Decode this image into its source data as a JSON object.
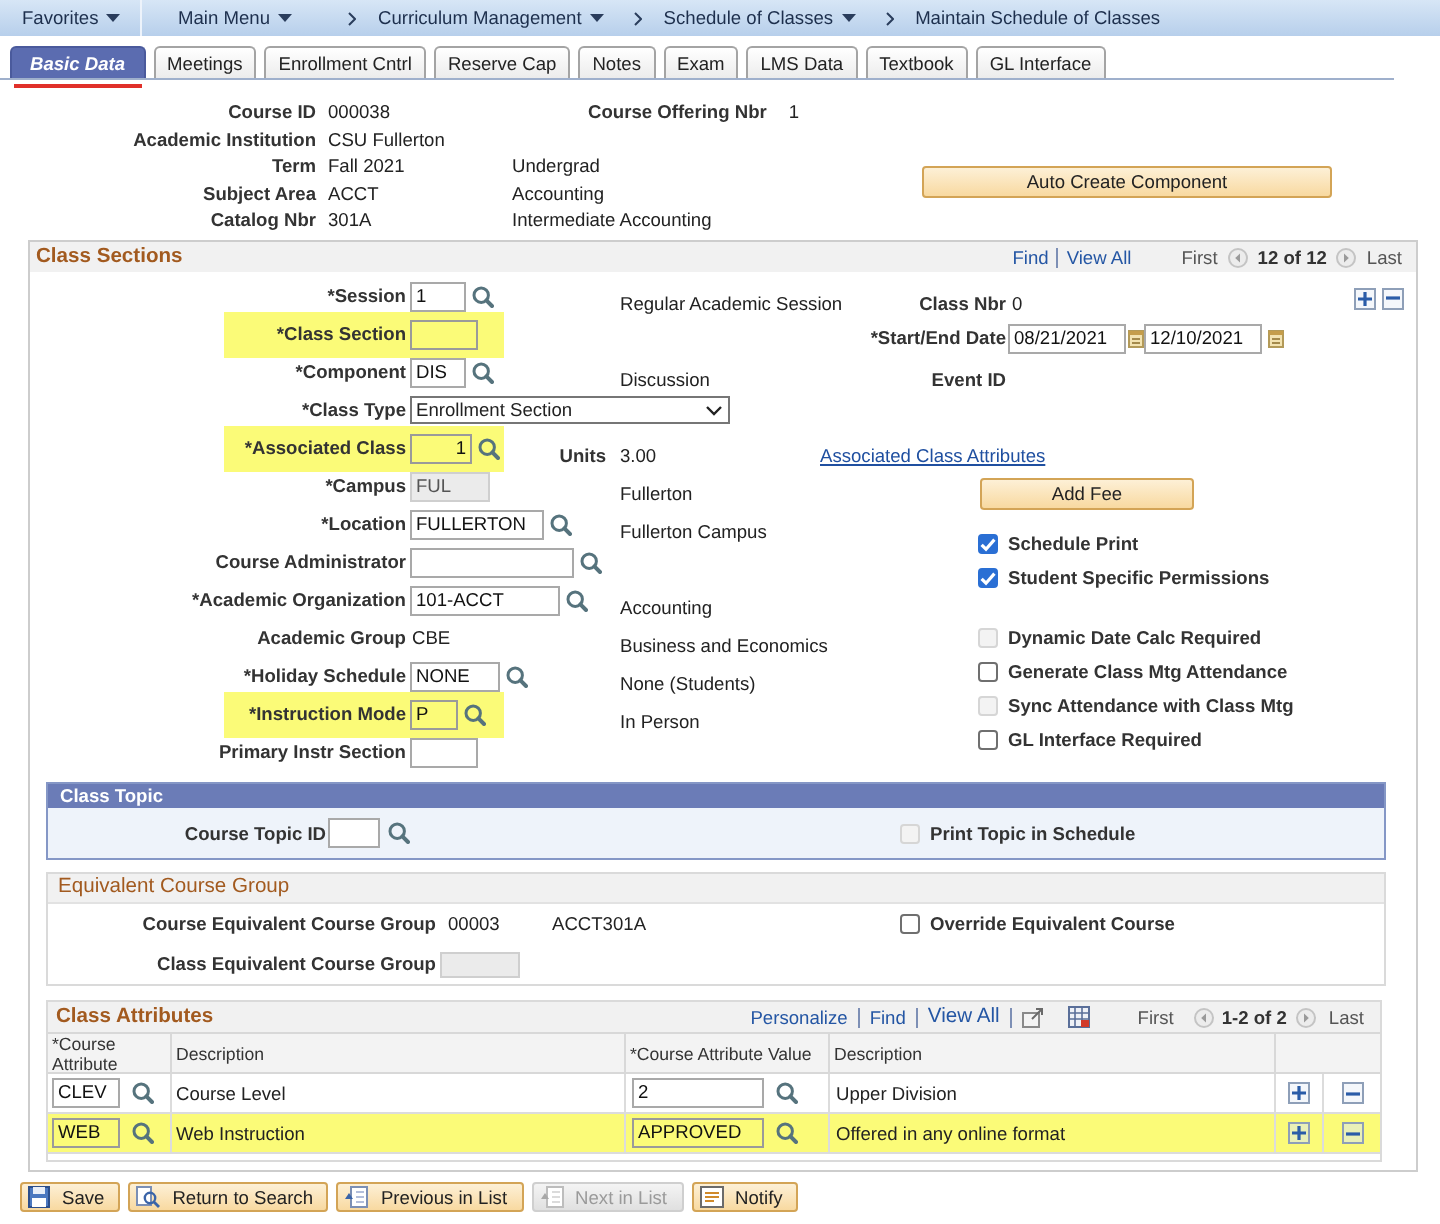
{
  "breadcrumbs": [
    {
      "label": "Favorites",
      "dropdown": true
    },
    {
      "label": "Main Menu",
      "dropdown": true
    },
    {
      "label": "Curriculum Management",
      "dropdown": true
    },
    {
      "label": "Schedule of Classes",
      "dropdown": true
    },
    {
      "label": "Maintain Schedule of Classes",
      "dropdown": false
    }
  ],
  "tabs": [
    {
      "label": "Basic Data",
      "selected": true
    },
    {
      "label": "Meetings",
      "selected": false
    },
    {
      "label": "Enrollment Cntrl",
      "selected": false
    },
    {
      "label": "Reserve Cap",
      "selected": false
    },
    {
      "label": "Notes",
      "selected": false
    },
    {
      "label": "Exam",
      "selected": false
    },
    {
      "label": "LMS Data",
      "selected": false
    },
    {
      "label": "Textbook",
      "selected": false
    },
    {
      "label": "GL Interface",
      "selected": false
    }
  ],
  "course": {
    "fields": [
      {
        "label": "Course ID",
        "value": "000038"
      },
      {
        "label": "Academic Institution",
        "value": "CSU Fullerton"
      },
      {
        "label": "Term",
        "value": "Fall 2021",
        "description": "Undergrad"
      },
      {
        "label": "Subject Area",
        "value": "ACCT",
        "description": "Accounting"
      },
      {
        "label": "Catalog Nbr",
        "value": "301A",
        "description": "Intermediate Accounting"
      }
    ],
    "offering": {
      "label": "Course Offering Nbr",
      "value": "1"
    },
    "action_button": "Auto Create Component"
  },
  "class_sections": {
    "title": "Class Sections",
    "pager": {
      "find": "Find",
      "view_all": "View All",
      "first": "First",
      "position": "12 of 12",
      "last": "Last"
    },
    "fields": [
      {
        "label": "*Session",
        "kind": "lookup",
        "value": "1",
        "description": "Regular Academic Session",
        "highlighted": false
      },
      {
        "label": "*Class Section",
        "kind": "input",
        "highlighted": true
      },
      {
        "label": "*Component",
        "kind": "lookup",
        "value": "DIS",
        "description": "Discussion",
        "highlighted": false
      },
      {
        "label": "*Class Type",
        "kind": "select",
        "value": "Enrollment Section",
        "highlighted": false
      },
      {
        "label": "*Associated Class",
        "kind": "numeric",
        "value": "1",
        "units": {
          "label": "Units",
          "value": "3.00"
        },
        "highlighted": true
      },
      {
        "label": "*Campus",
        "kind": "readonly",
        "value": "FUL",
        "description": "Fullerton",
        "highlighted": false
      },
      {
        "label": "*Location",
        "kind": "lookup",
        "value": "FULLERTON",
        "description": "Fullerton Campus",
        "highlighted": false
      },
      {
        "label": "Course Administrator",
        "kind": "lookup",
        "highlighted": false
      },
      {
        "label": "*Academic Organization",
        "kind": "lookup",
        "value": "101-ACCT",
        "description": "Accounting",
        "highlighted": false
      },
      {
        "label": "Academic Group",
        "kind": "text",
        "value": "CBE",
        "description": "Business and Economics",
        "highlighted": false
      },
      {
        "label": "*Holiday Schedule",
        "kind": "lookup",
        "value": "NONE",
        "description": "None (Students)",
        "highlighted": false
      },
      {
        "label": "*Instruction Mode",
        "kind": "lookup",
        "value": "P",
        "description": "In Person",
        "highlighted": true
      },
      {
        "label": "Primary Instr Section",
        "kind": "input",
        "highlighted": false
      }
    ],
    "side": [
      {
        "kind": "display",
        "label": "Class Nbr",
        "value": "0"
      },
      {
        "kind": "daterange",
        "label": "*Start/End Date",
        "start": "08/21/2021",
        "end": "12/10/2021"
      },
      {
        "kind": "display",
        "label": "Event ID"
      },
      {
        "kind": "link",
        "label": "Associated Class Attributes"
      },
      {
        "kind": "button",
        "label": "Add Fee"
      }
    ],
    "option_groups": [
      {
        "items": [
          {
            "label": "Schedule Print",
            "checked": true,
            "disabled": false
          },
          {
            "label": "Student Specific Permissions",
            "checked": true,
            "disabled": false
          }
        ]
      },
      {
        "items": [
          {
            "label": "Dynamic Date Calc Required",
            "checked": false,
            "disabled": true
          },
          {
            "label": "Generate Class Mtg Attendance",
            "checked": false,
            "disabled": false
          },
          {
            "label": "Sync Attendance with Class Mtg",
            "checked": false,
            "disabled": true
          },
          {
            "label": "GL Interface Required",
            "checked": false,
            "disabled": false
          }
        ]
      }
    ]
  },
  "class_topic": {
    "title": "Class Topic",
    "field": {
      "label": "Course Topic ID"
    },
    "option": {
      "label": "Print Topic in Schedule",
      "checked": false,
      "disabled": true
    }
  },
  "equivalent_course_group": {
    "title": "Equivalent Course Group",
    "course_group": {
      "label": "Course Equivalent Course Group",
      "value": "00003",
      "description": "ACCT301A"
    },
    "class_group": {
      "label": "Class Equivalent Course Group"
    },
    "option": {
      "label": "Override Equivalent Course",
      "checked": false,
      "disabled": false
    }
  },
  "class_attributes": {
    "title": "Class Attributes",
    "toolbar": {
      "personalize": "Personalize",
      "find": "Find",
      "view_all": "View All",
      "first": "First",
      "position": "1-2 of 2",
      "last": "Last"
    },
    "columns": [
      "*Course Attribute",
      "Description",
      "*Course Attribute Value",
      "Description"
    ],
    "rows": [
      {
        "attribute": "CLEV",
        "description": "Course Level",
        "value": "2",
        "value_description": "Upper Division",
        "highlighted": false
      },
      {
        "attribute": "WEB",
        "description": "Web Instruction",
        "value": "APPROVED",
        "value_description": "Offered in any online format",
        "highlighted": true
      }
    ]
  },
  "buttons": [
    {
      "label": "Save",
      "kind": "save",
      "disabled": false
    },
    {
      "label": "Return to Search",
      "kind": "search",
      "disabled": false
    },
    {
      "label": "Previous in List",
      "kind": "previous",
      "disabled": false
    },
    {
      "label": "Next in List",
      "kind": "next",
      "disabled": true
    },
    {
      "label": "Notify",
      "kind": "notify",
      "disabled": false
    }
  ]
}
